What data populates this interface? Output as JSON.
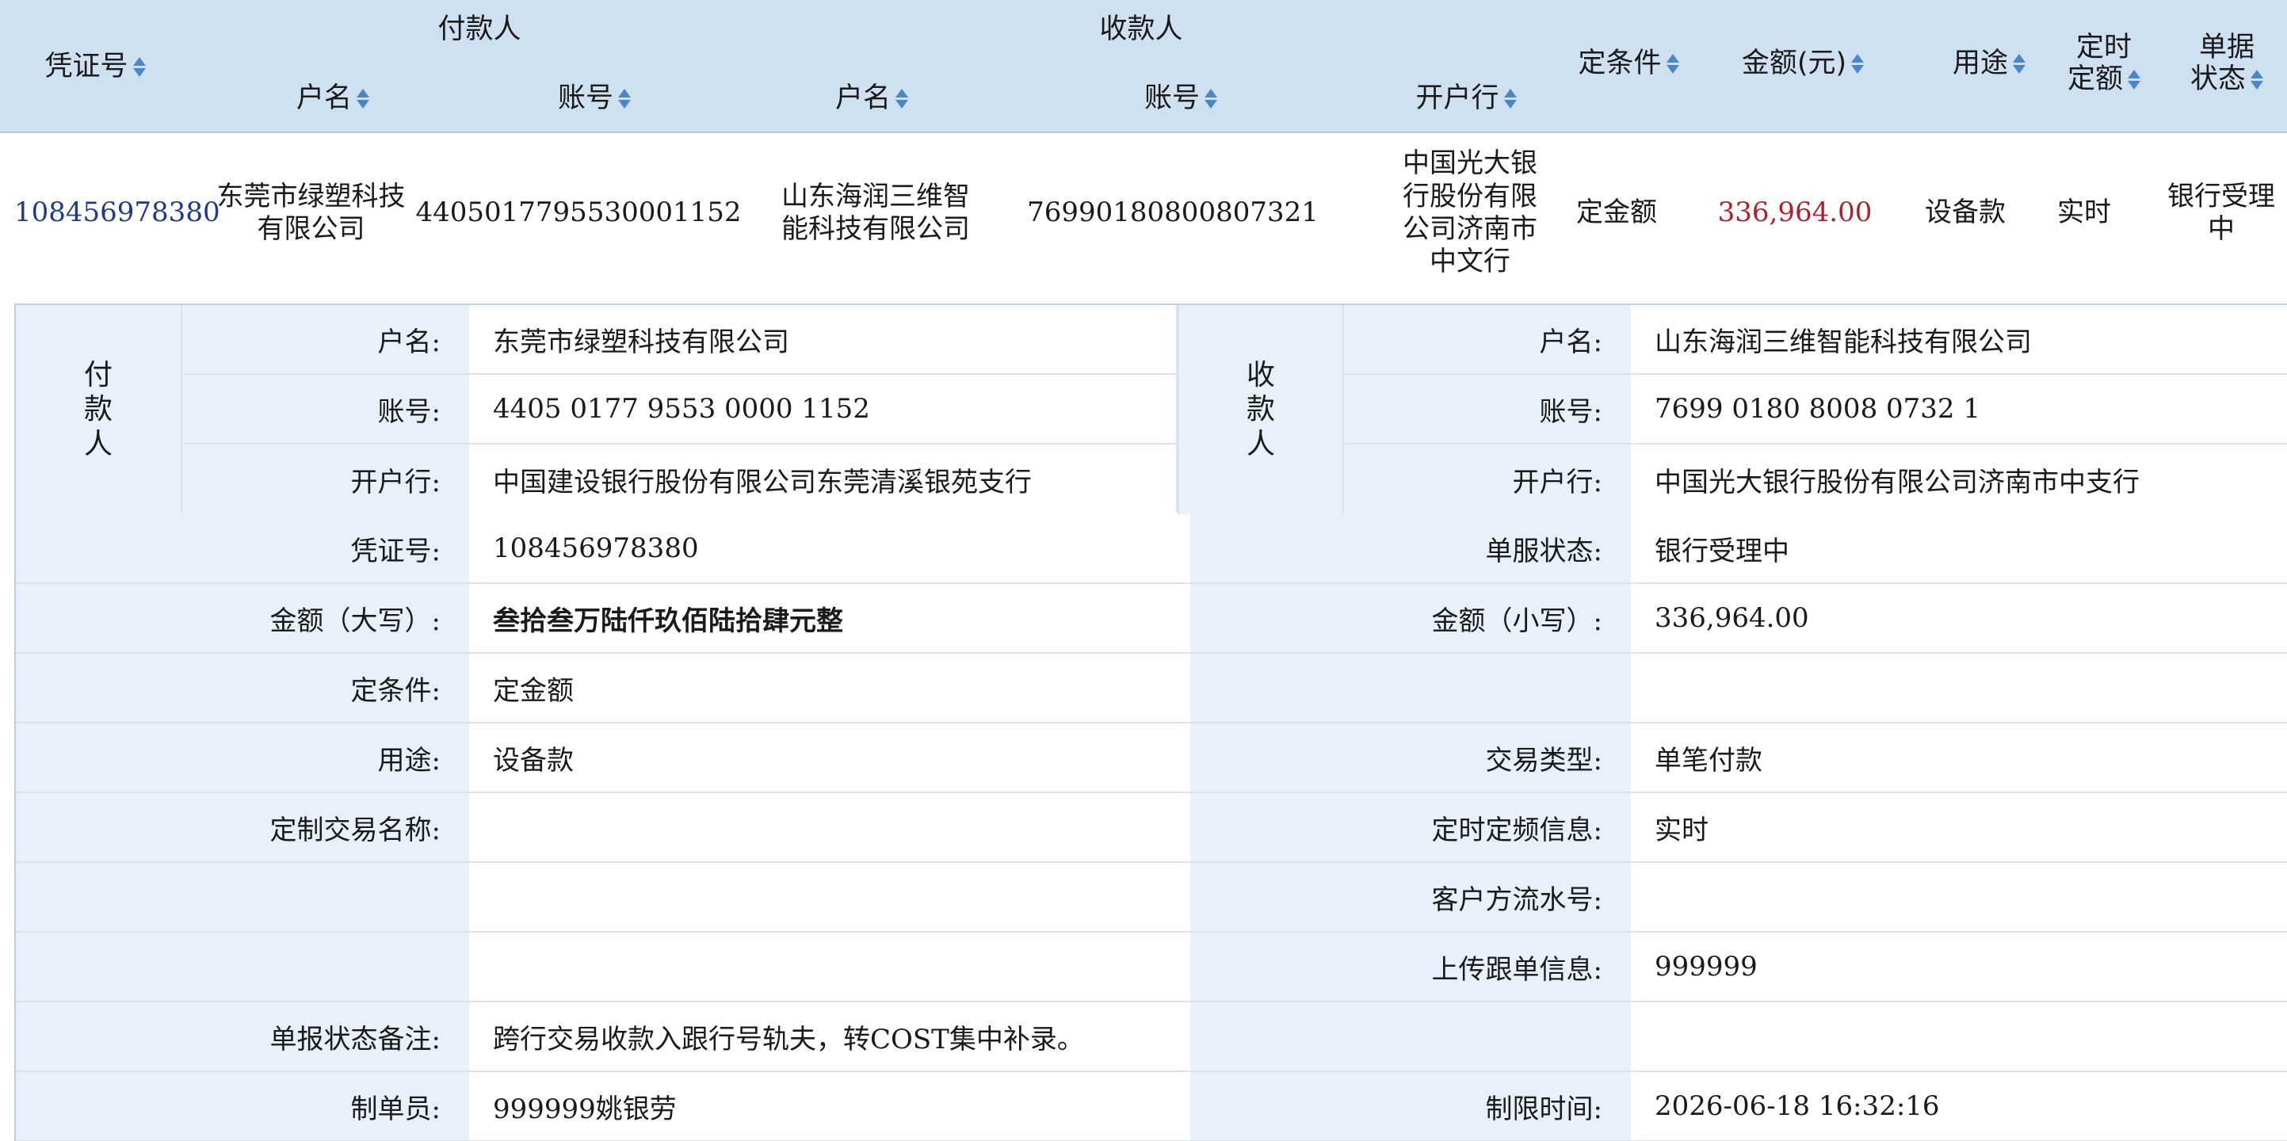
{
  "list": {
    "headers": {
      "voucher_no": "凭证号",
      "payer_group": "付款人",
      "payee_group": "收款人",
      "payer_name": "户名",
      "payer_account": "账号",
      "payee_name": "户名",
      "payee_account": "账号",
      "payee_bank": "开户行",
      "condition": "定条件",
      "amount": "金额(元)",
      "purpose": "用途",
      "timing_l1": "定时",
      "timing_l2": "定额",
      "status_l1": "单据",
      "status_l2": "状态"
    },
    "row": {
      "voucher_no": "108456978380",
      "payer_name_l1": "东莞市绿塑科技",
      "payer_name_l2": "有限公司",
      "payer_account": "4405017795530001152",
      "payee_name_l1": "山东海润三维智",
      "payee_name_l2": "能科技有限公司",
      "payee_account": "76990180800807321",
      "payee_bank_l1": "中国光大银",
      "payee_bank_l2": "行股份有限",
      "payee_bank_l3": "公司济南市",
      "payee_bank_l4": "中文行",
      "condition": "定金额",
      "amount": "336,964.00",
      "purpose": "设备款",
      "timing": "实时",
      "status": "银行受理中"
    }
  },
  "detail": {
    "payer": {
      "side_l1": "付",
      "side_l2": "款",
      "side_l3": "人",
      "name_label": "户名:",
      "name": "东莞市绿塑科技有限公司",
      "account_label": "账号:",
      "account": "4405 0177 9553 0000 1152",
      "bank_label": "开户行:",
      "bank": "中国建设银行股份有限公司东莞清溪银苑支行"
    },
    "payee": {
      "side_l1": "收",
      "side_l2": "款",
      "side_l3": "人",
      "name_label": "户名:",
      "name": "山东海润三维智能科技有限公司",
      "account_label": "账号:",
      "account": "7699 0180 8008 0732 1",
      "bank_label": "开户行:",
      "bank": "中国光大银行股份有限公司济南市中支行"
    },
    "rows": [
      {
        "left_label": "凭证号:",
        "left_value": "108456978380",
        "right_label": "单服状态:",
        "right_value": "银行受理中"
      },
      {
        "left_label": "金额（大写）:",
        "left_value": "叁拾叁万陆仟玖佰陆拾肆元整",
        "right_label": "金额（小写）:",
        "right_value": "336,964.00"
      },
      {
        "left_label": "定条件:",
        "left_value": "定金额",
        "right_label": "",
        "right_value": ""
      },
      {
        "left_label": "用途:",
        "left_value": "设备款",
        "right_label": "交易类型:",
        "right_value": "单笔付款"
      },
      {
        "left_label": "定制交易名称:",
        "left_value": "",
        "right_label": "定时定频信息:",
        "right_value": "实时"
      },
      {
        "left_label": "",
        "left_value": "",
        "right_label": "客户方流水号:",
        "right_value": ""
      },
      {
        "left_label": "",
        "left_value": "",
        "right_label": "上传跟单信息:",
        "right_value": "999999"
      },
      {
        "left_label": "单报状态备注:",
        "left_value": "跨行交易收款入跟行号轨夫，转COST集中补录。",
        "right_label": "",
        "right_value": ""
      },
      {
        "left_label": "制单员:",
        "left_value": "999999姚银劳",
        "right_label": "制限时间:",
        "right_value": "2026-06-18 16:32:16"
      }
    ]
  },
  "colors": {
    "header_bg": "#cfe0f0",
    "label_bg": "#e8f1f9",
    "sort_arrow": "#4a86c8",
    "amount_text": "#b01f2a",
    "voucher_link": "#1f3a8a"
  }
}
